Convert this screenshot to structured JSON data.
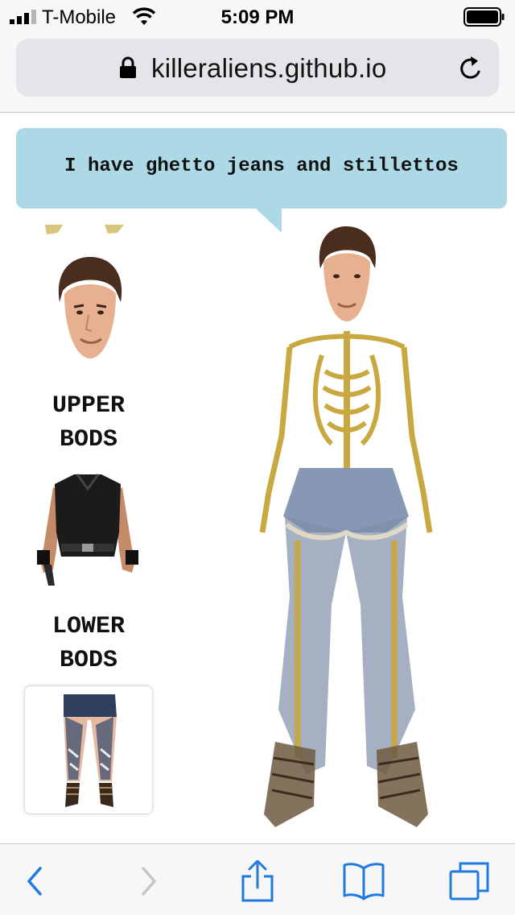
{
  "status_bar": {
    "carrier": "T-Mobile",
    "time": "5:09 PM"
  },
  "browser": {
    "url": "killeraliens.github.io"
  },
  "speech_bubble": {
    "text": "I have ghetto jeans and stillettos"
  },
  "picker": {
    "upper_label": "UPPER BODS",
    "lower_label": "LOWER BODS"
  },
  "colors": {
    "bubble": "#add8e6",
    "toolbar_icons": "#1f7bdf",
    "toolbar_disabled": "#c2c7cd"
  },
  "icons": [
    "signal-icon",
    "wifi-icon",
    "battery-icon",
    "lock-icon",
    "reload-icon",
    "back-icon",
    "forward-icon",
    "share-icon",
    "bookmarks-icon",
    "tabs-icon"
  ]
}
